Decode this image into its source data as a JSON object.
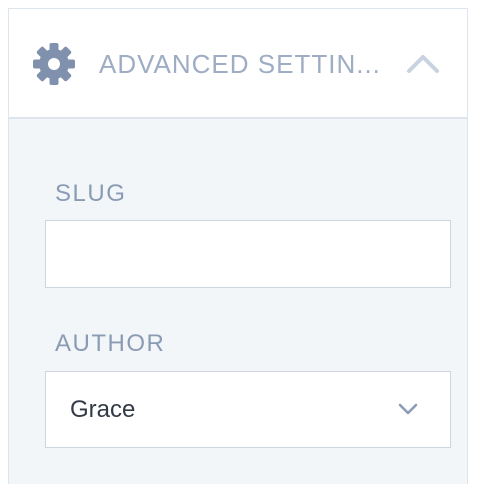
{
  "panel": {
    "title": "ADVANCED SETTIN...",
    "header_icon": "gear-icon",
    "collapse_icon": "chevron-up-icon",
    "expanded": true
  },
  "fields": {
    "slug": {
      "label": "SLUG",
      "value": "",
      "placeholder": ""
    },
    "author": {
      "label": "AUTHOR",
      "selected": "Grace",
      "dropdown_icon": "chevron-down-icon"
    }
  },
  "colors": {
    "header_text": "#9eadc3",
    "label_text": "#8a9bb4",
    "panel_background": "#f3f6f9",
    "border": "#cfd6df"
  }
}
